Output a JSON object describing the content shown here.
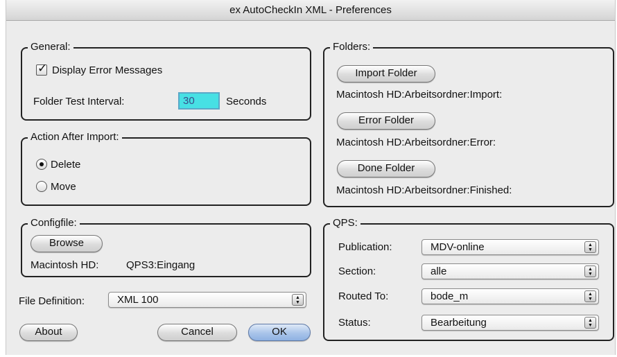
{
  "window": {
    "title": "ex AutoCheckIn XML - Preferences"
  },
  "general": {
    "title": "General:",
    "display_errors_label": "Display Error Messages",
    "display_errors_checked": true,
    "interval_label": "Folder Test Interval:",
    "interval_value": "30",
    "interval_unit": "Seconds"
  },
  "action": {
    "title": "Action After Import:",
    "delete_label": "Delete",
    "move_label": "Move",
    "selected": "Delete"
  },
  "configfile": {
    "title": "Configfile:",
    "browse_label": "Browse",
    "volume": "Macintosh HD:",
    "path": "QPS3:Eingang"
  },
  "file_definition": {
    "label": "File Definition:",
    "value": "XML 100"
  },
  "buttons": {
    "about": "About",
    "cancel": "Cancel",
    "ok": "OK"
  },
  "folders": {
    "title": "Folders:",
    "import_label": "Import Folder",
    "import_path": "Macintosh HD:Arbeitsordner:Import:",
    "error_label": "Error Folder",
    "error_path": "Macintosh HD:Arbeitsordner:Error:",
    "done_label": "Done Folder",
    "done_path": "Macintosh HD:Arbeitsordner:Finished:"
  },
  "qps": {
    "title": "QPS:",
    "publication_label": "Publication:",
    "publication_value": "MDV-online",
    "section_label": "Section:",
    "section_value": "alle",
    "routed_label": "Routed To:",
    "routed_value": "bode_m",
    "status_label": "Status:",
    "status_value": "Bearbeitung"
  },
  "colors": {
    "field_highlight": "#47e0e4",
    "default_button": "#a9c4ea",
    "window_bg": "#ececec"
  }
}
